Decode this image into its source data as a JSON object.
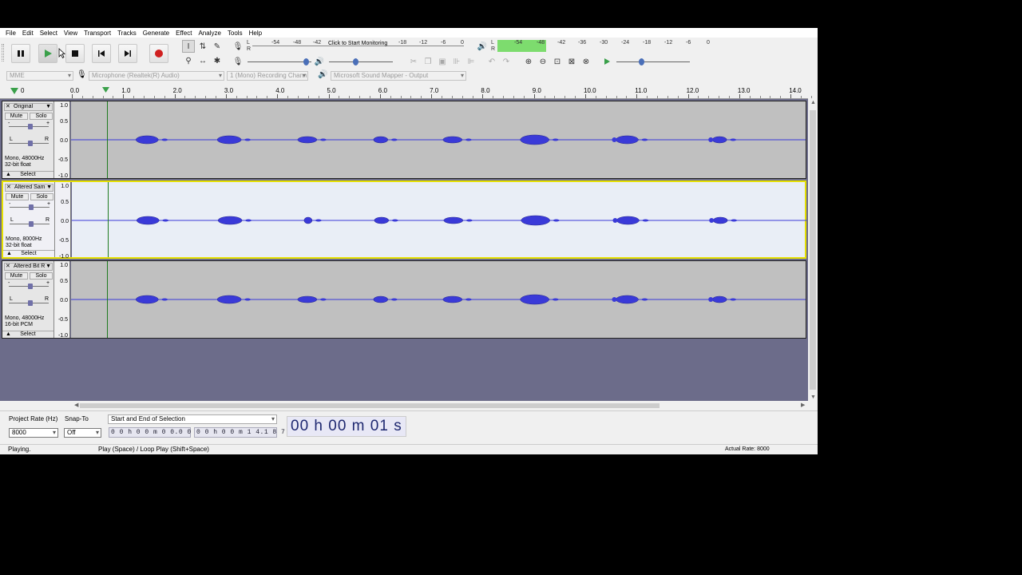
{
  "menu": [
    "File",
    "Edit",
    "Select",
    "View",
    "Transport",
    "Tracks",
    "Generate",
    "Effect",
    "Analyze",
    "Tools",
    "Help"
  ],
  "transport": {
    "pause": "pause-icon",
    "play": "play-icon",
    "stop": "stop-icon",
    "skip_start": "skip-start-icon",
    "skip_end": "skip-end-icon",
    "record": "record-icon"
  },
  "meters": {
    "record_ticks": [
      "-54",
      "-48",
      "-42",
      "Click to Start Monitoring",
      "-18",
      "-12",
      "-6",
      "0"
    ],
    "play_ticks": [
      "-54",
      "-48",
      "-42",
      "-36",
      "-30",
      "-24",
      "-18",
      "-12",
      "-6",
      "0"
    ],
    "rec_lr": [
      "L",
      "R"
    ],
    "play_lr": [
      "L",
      "R"
    ]
  },
  "device": {
    "host": "MME",
    "mic": "Microphone (Realtek(R) Audio)",
    "channels": "1 (Mono) Recording Chann",
    "output": "Microsoft Sound Mapper - Output"
  },
  "ruler": {
    "zero": "0",
    "labels": [
      "0.0",
      "1.0",
      "2.0",
      "3.0",
      "4.0",
      "5.0",
      "6.0",
      "7.0",
      "8.0",
      "9.0",
      "10.0",
      "11.0",
      "12.0",
      "13.0",
      "14.0"
    ]
  },
  "vruler": [
    "1.0",
    "0.5",
    "0.0",
    "-0.5",
    "-1.0"
  ],
  "tracks": [
    {
      "name": "Original",
      "mute": "Mute",
      "solo": "Solo",
      "pan_l": "L",
      "pan_r": "R",
      "info1": "Mono, 48000Hz",
      "info2": "32-bit float",
      "select": "Select",
      "selected": false,
      "reduced": false
    },
    {
      "name": "Altered Sam",
      "mute": "Mute",
      "solo": "Solo",
      "pan_l": "L",
      "pan_r": "R",
      "info1": "Mono, 8000Hz",
      "info2": "32-bit float",
      "select": "Select",
      "selected": true,
      "reduced": true
    },
    {
      "name": "Altered Bit R",
      "mute": "Mute",
      "solo": "Solo",
      "pan_l": "L",
      "pan_r": "R",
      "info1": "Mono, 48000Hz",
      "info2": "16-bit PCM",
      "select": "Select",
      "selected": false,
      "reduced": false
    }
  ],
  "waveform": {
    "duration_s": 14.187,
    "bursts_s": [
      1.45,
      3.05,
      4.57,
      6.0,
      7.4,
      9.0,
      10.8,
      12.6
    ],
    "playhead_s": 0.67
  },
  "selection": {
    "project_rate_label": "Project Rate (Hz)",
    "project_rate": "8000",
    "snap_label": "Snap-To",
    "snap": "Off",
    "mode": "Start and End of Selection",
    "start": "0 0 h 0 0 m 0 0.0 0 0 s",
    "end": "0 0 h 0 0 m 1 4.1 8 7 s",
    "audio_position": "00 h 00 m 01 s"
  },
  "status": {
    "left": "Playing.",
    "middle": "Play (Space) / Loop Play (Shift+Space)",
    "right": "Actual Rate: 8000"
  },
  "colors": {
    "wave": "#3a3ad8",
    "wave_edge": "#23238a",
    "playhead": "#1f7a1f",
    "selected_border": "#e6e000",
    "record": "#d02020",
    "meter_green": "#7ddc6e"
  }
}
